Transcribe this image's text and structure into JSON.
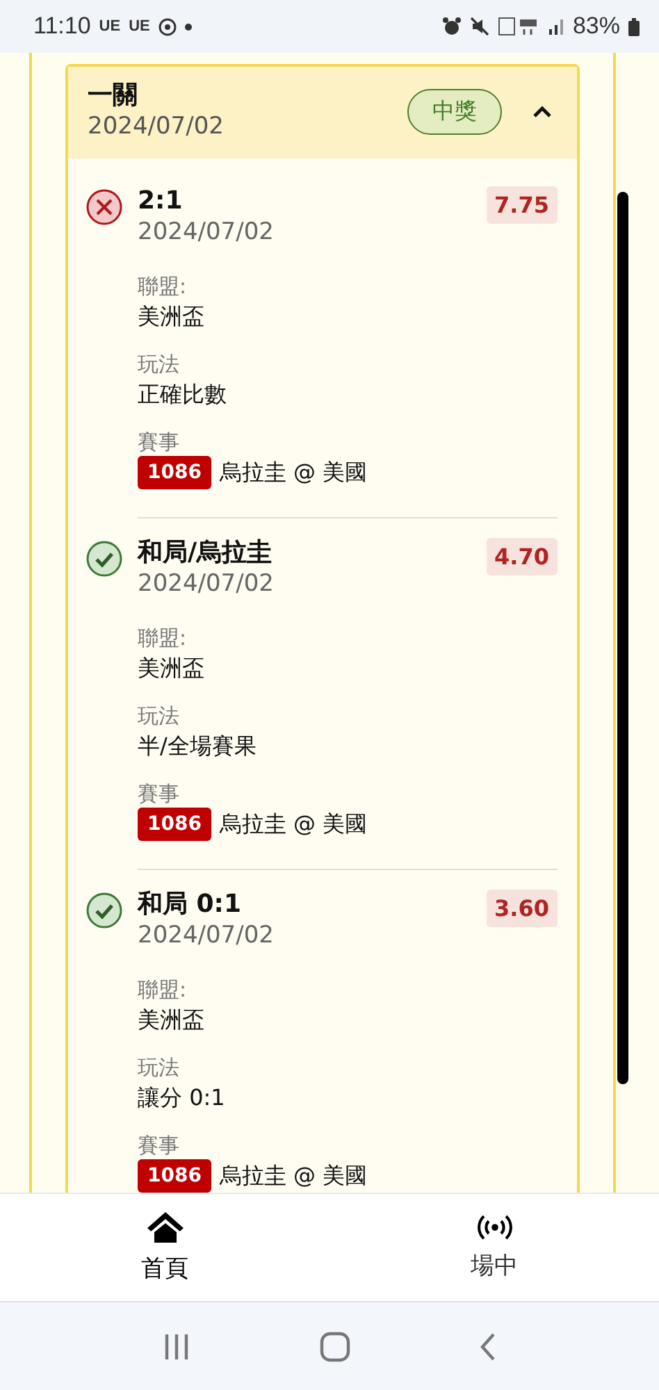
{
  "status_bar": {
    "time": "11:10",
    "indicators": [
      "UE",
      "UE"
    ],
    "battery": "83%"
  },
  "card": {
    "title": "一關",
    "date": "2024/07/02",
    "badge": "中獎",
    "expanded": true,
    "legs": [
      {
        "kind": "lost",
        "selection": "2:1",
        "date": "2024/07/02",
        "odds": "7.75",
        "fields": [
          {
            "label": "聯盟:",
            "value": "美洲盃"
          },
          {
            "label": "玩法",
            "value": "正確比數"
          },
          {
            "label": "賽事",
            "event_id": "1086",
            "value": "烏拉圭 @ 美國"
          }
        ]
      },
      {
        "kind": "won",
        "selection": "和局/烏拉圭",
        "date": "2024/07/02",
        "odds": "4.70",
        "fields": [
          {
            "label": "聯盟:",
            "value": "美洲盃"
          },
          {
            "label": "玩法",
            "value": "半/全場賽果"
          },
          {
            "label": "賽事",
            "event_id": "1086",
            "value": "烏拉圭 @ 美國"
          }
        ]
      },
      {
        "kind": "won",
        "selection": "和局 0:1",
        "date": "2024/07/02",
        "odds": "3.60",
        "fields": [
          {
            "label": "聯盟:",
            "value": "美洲盃"
          },
          {
            "label": "玩法",
            "value": "讓分 0:1"
          },
          {
            "label": "賽事",
            "event_id": "1086",
            "value": "烏拉圭 @ 美國"
          }
        ]
      }
    ]
  },
  "bottom_nav": [
    {
      "label": "首頁",
      "selected": true
    },
    {
      "label": "場中",
      "selected": false
    }
  ]
}
